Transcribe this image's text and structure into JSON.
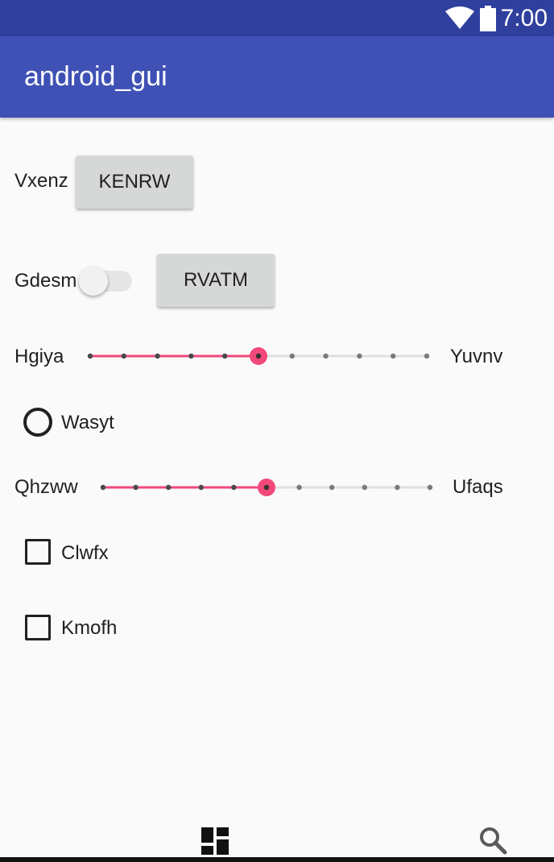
{
  "status_bar": {
    "time": "7:00",
    "icons": [
      "wifi-icon",
      "battery-icon"
    ]
  },
  "app_bar": {
    "title": "android_gui"
  },
  "row1": {
    "label": "Vxenz",
    "button": "KENRW"
  },
  "row2": {
    "label": "Gdesm",
    "switch_on": false,
    "button": "RVATM"
  },
  "slider1": {
    "left_label": "Hgiya",
    "right_label": "Yuvnv",
    "steps": 10,
    "value": 5
  },
  "radio": {
    "label": "Wasyt",
    "checked": false
  },
  "slider2": {
    "left_label": "Qhzww",
    "right_label": "Ufaqs",
    "steps": 10,
    "value": 5
  },
  "checkbox1": {
    "label": "Clwfx",
    "checked": false
  },
  "checkbox2": {
    "label": "Kmofh",
    "checked": false
  },
  "bottom_icons": [
    "dashboard-icon",
    "search-icon"
  ],
  "colors": {
    "accent": "#f2487a",
    "primary": "#3f51b5",
    "primary_dark": "#2f3f9e"
  }
}
